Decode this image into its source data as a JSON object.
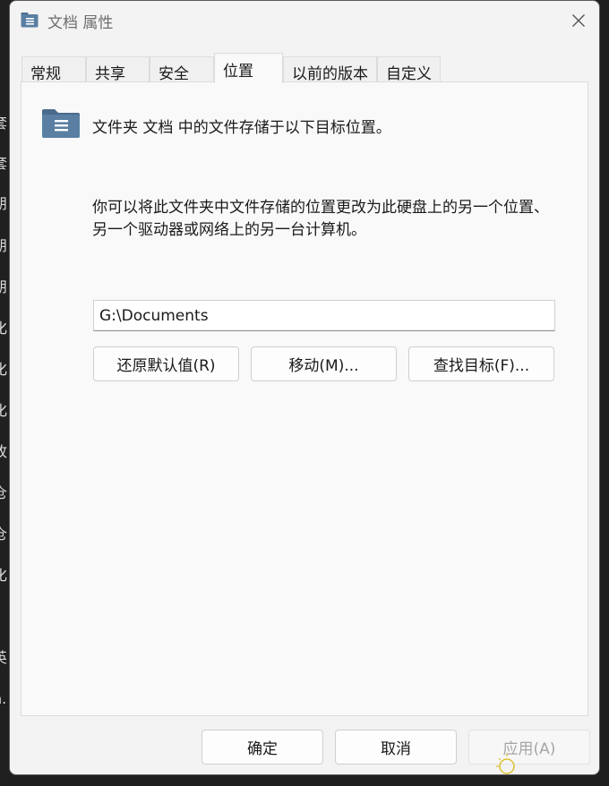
{
  "background": {
    "partial_chars": [
      "套",
      "套",
      "朋",
      "朋",
      "朋",
      "化",
      "化",
      "化",
      "故",
      "仓",
      "仓",
      "化",
      "英",
      "n."
    ]
  },
  "window": {
    "title": "文档 属性",
    "title_icon": "folder-properties-icon",
    "close_icon": "close-icon"
  },
  "tabs": [
    {
      "label": "常规",
      "active": false
    },
    {
      "label": "共享",
      "active": false
    },
    {
      "label": "安全",
      "active": false
    },
    {
      "label": "位置",
      "active": true
    },
    {
      "label": "以前的版本",
      "active": false
    },
    {
      "label": "自定义",
      "active": false
    }
  ],
  "location": {
    "folder_icon": "documents-folder-icon",
    "heading": "文件夹 文档 中的文件存储于以下目标位置。",
    "description": "你可以将此文件夹中文件存储的位置更改为此硬盘上的另一个位置、另一个驱动器或网络上的另一台计算机。",
    "path_value": "G:\\Documents",
    "restore_default_label": "还原默认值(R)",
    "move_label": "移动(M)...",
    "find_target_label": "查找目标(F)..."
  },
  "footer": {
    "ok_label": "确定",
    "cancel_label": "取消",
    "apply_label": "应用(A)"
  },
  "colors": {
    "window_bg": "#f3f3f3",
    "panel_bg": "#f9f9f9",
    "folder_icon": "#5a7fa3",
    "text": "#1a1a1a",
    "disabled_text": "#a6a6a6"
  }
}
